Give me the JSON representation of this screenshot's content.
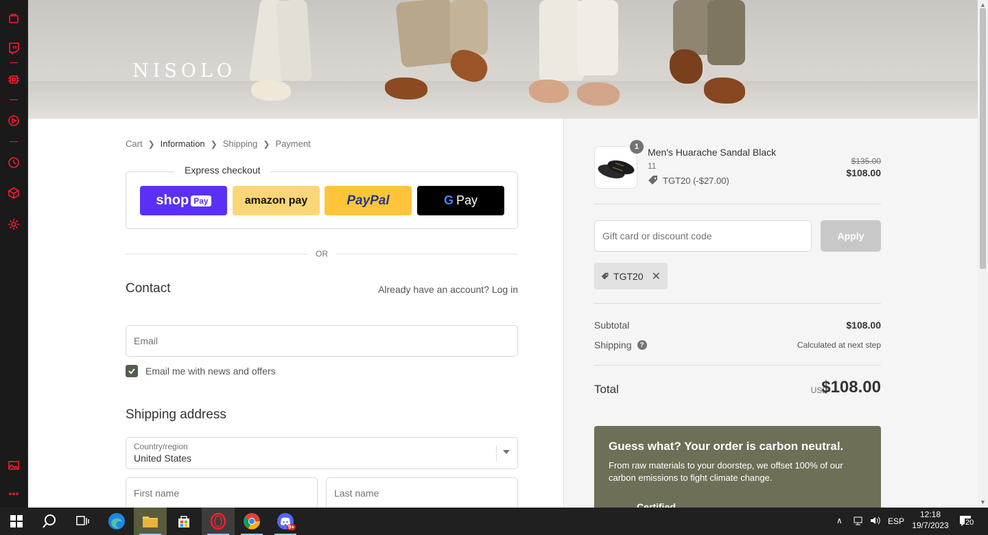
{
  "brand": "NISOLO",
  "breadcrumb": {
    "cart": "Cart",
    "information": "Information",
    "shipping": "Shipping",
    "payment": "Payment"
  },
  "express": {
    "title": "Express checkout",
    "shop_pay": "shop",
    "shop_pay_badge": "Pay",
    "amazon_pay": "amazon pay",
    "paypal": "PayPal",
    "gpay": "Pay"
  },
  "or_divider": "OR",
  "contact": {
    "title": "Contact",
    "login_text": "Already have an account? Log in",
    "email_placeholder": "Email",
    "newsletter_label": "Email me with news and offers",
    "newsletter_checked": true
  },
  "shipping_address": {
    "title": "Shipping address",
    "country_label": "Country/region",
    "country_value": "United States",
    "first_name_placeholder": "First name",
    "last_name_placeholder": "Last name"
  },
  "summary": {
    "product": {
      "quantity": "1",
      "name": "Men's Huarache Sandal Black",
      "size": "11",
      "discount": "TGT20 (-$27.00)",
      "price_original": "$135.00",
      "price_final": "$108.00"
    },
    "discount_placeholder": "Gift card or discount code",
    "apply_label": "Apply",
    "applied_code": "TGT20",
    "subtotal_label": "Subtotal",
    "subtotal_value": "$108.00",
    "shipping_label": "Shipping",
    "shipping_value": "Calculated at next step",
    "total_label": "Total",
    "total_currency": "USD",
    "total_value": "$108.00",
    "carbon": {
      "title": "Guess what? Your order is carbon neutral.",
      "text": "From raw materials to your doorstep, we offset 100% of our carbon emissions to fight climate change.",
      "cert": "Certified"
    }
  },
  "taskbar": {
    "language": "ESP",
    "time": "12:18",
    "date": "19/7/2023",
    "notifications": "20",
    "discord_badge": "9+"
  },
  "colors": {
    "accent_opera": "#ff1b2d",
    "shop_pay": "#5a31f4",
    "amazon_pay": "#fad676",
    "paypal": "#ffc439",
    "carbon_box": "#6e6f57",
    "checkbox": "#545d4a"
  }
}
